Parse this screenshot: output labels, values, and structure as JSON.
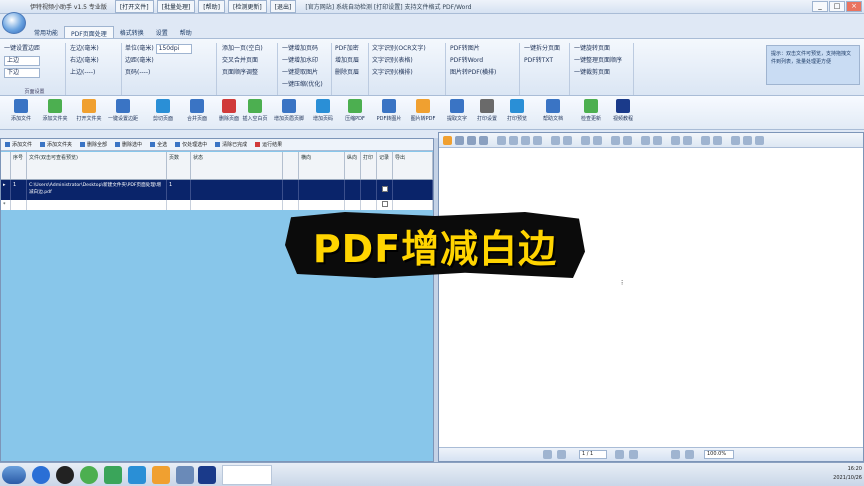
{
  "window": {
    "title": "伊特视频小助手 v1.5 专业版",
    "menu_tabs": [
      "[打开文件]",
      "[批量处理]",
      "[帮助]",
      "[检测更新]",
      "[退出]"
    ],
    "extra": "[官方网站] 系统自动检测 [打印设置] 支持文件格式 PDF/Word",
    "controls": [
      "_",
      "□",
      "×"
    ]
  },
  "ribbon_tabs": [
    "常用功能",
    "PDF页面处理",
    "格式转换",
    "设置",
    "帮助"
  ],
  "ribbon_active_tab": "PDF页面处理",
  "ribbon": {
    "group1": {
      "rows": [
        "一键设置边距",
        "上边",
        "下边"
      ],
      "label": "页面设置"
    },
    "group2": {
      "rows": [
        "左边(毫米)",
        "右边(毫米)",
        "上边(----)"
      ]
    },
    "group3": {
      "rows": [
        "单位(毫米)",
        "边距(毫米)",
        "页码(----)"
      ],
      "select": "150dpi"
    },
    "group4": {
      "rows": [
        "添加一页(空白)",
        "交叉合并页面",
        "页面顺序调整"
      ]
    },
    "group5": {
      "rows": [
        "一键增加页码",
        "一键增加水印",
        "一键提取图片",
        "一键压缩(优化)"
      ]
    },
    "group6": {
      "rows": [
        "PDF加密",
        "增加页眉",
        "删除页眉"
      ]
    },
    "group7": {
      "rows": [
        "文字识别(OCR文字)",
        "文字识别(表格)",
        "文字识别(横排)"
      ]
    },
    "group8": {
      "rows": [
        "PDF转图片",
        "PDF转Word",
        "图片转PDF(横排)"
      ]
    },
    "group9": {
      "rows": [
        "一键拆分页面",
        "PDF转TXT"
      ]
    },
    "group10": {
      "rows": [
        "一键旋转页面",
        "一键整理页面顺序",
        "一键裁剪页面"
      ]
    },
    "note": "提示：双击文件可预览，支持拖拽文件到列表，批量处理更方便"
  },
  "tools": [
    {
      "label": "添加文件",
      "color": "#3a74c4"
    },
    {
      "label": "添加文件夹",
      "color": "#4caf50"
    },
    {
      "label": "打开文件夹",
      "color": "#f0a030"
    },
    {
      "label": "一键设置边距",
      "color": "#3a74c4"
    },
    {
      "label": "剪切页面",
      "color": "#2a8fd6"
    },
    {
      "label": "合并页面",
      "color": "#3a74c4"
    },
    {
      "label": "删除页面",
      "color": "#d03a3a"
    },
    {
      "label": "插入空白页",
      "color": "#4caf50"
    },
    {
      "label": "增加页眉页脚",
      "color": "#3a74c4"
    },
    {
      "label": "增加页码",
      "color": "#2a8fd6"
    },
    {
      "label": "压缩PDF",
      "color": "#4caf50"
    },
    {
      "label": "PDF转图片",
      "color": "#3a74c4"
    },
    {
      "label": "图片转PDF",
      "color": "#f0a030"
    },
    {
      "label": "提取文字",
      "color": "#3a74c4"
    },
    {
      "label": "打印设置",
      "color": "#6a6a6a"
    },
    {
      "label": "打印预览",
      "color": "#2a8fd6"
    },
    {
      "label": "帮助文档",
      "color": "#3a74c4"
    },
    {
      "label": "检查更新",
      "color": "#4caf50"
    },
    {
      "label": "视频教程",
      "color": "#1a3a8a"
    }
  ],
  "list_toolbar": [
    "添加文件",
    "添加文件夹",
    "删除全部",
    "删除选中",
    "全选",
    "仅处理选中",
    "清除已完成",
    "运行结果"
  ],
  "grid": {
    "headers": [
      "",
      "序号",
      "文件(双击可查看预览)",
      "页数",
      "状态",
      "",
      "横向",
      "纵向",
      "打印",
      "记录",
      "导出"
    ],
    "rows": [
      {
        "index": "1",
        "file": "C:\\Users\\Administrator\\Desktop\\新建文件夹\\PDF页面处理\\增减白边.pdf",
        "pages": "1",
        "status": ""
      }
    ]
  },
  "preview": {
    "page_value": "1 / 1",
    "zoom_value": "100.0%"
  },
  "banner": "PDF增减白边",
  "tray": {
    "time": "16:20",
    "date": "2021/10/26"
  }
}
